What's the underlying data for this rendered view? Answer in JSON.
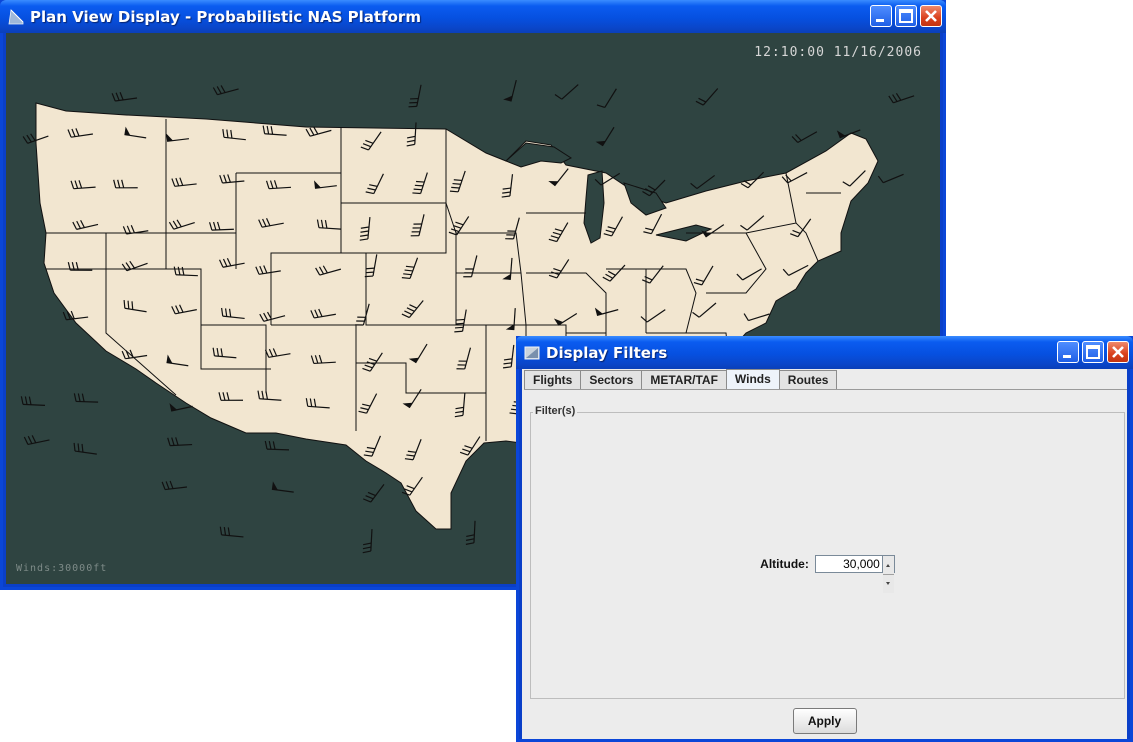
{
  "plan_view": {
    "title": "Plan View Display - Probabilistic NAS Platform",
    "clock": "12:10:00 11/16/2006",
    "winds_label": "Winds:30000ft",
    "map": {
      "background": "#2f4441",
      "land": "#f2e6d0",
      "lines": "#111111"
    }
  },
  "display_filters": {
    "title": "Display Filters",
    "tabs": [
      {
        "label": "Flights"
      },
      {
        "label": "Sectors"
      },
      {
        "label": "METAR/TAF"
      },
      {
        "label": "Winds",
        "active": true
      },
      {
        "label": "Routes"
      }
    ],
    "group_label": "Filter(s)",
    "altitude_label": "Altitude:",
    "altitude_value": "30,000",
    "apply_label": "Apply"
  },
  "colors": {
    "titlebar": "#0a57e8",
    "close_button": "#d9411c"
  }
}
